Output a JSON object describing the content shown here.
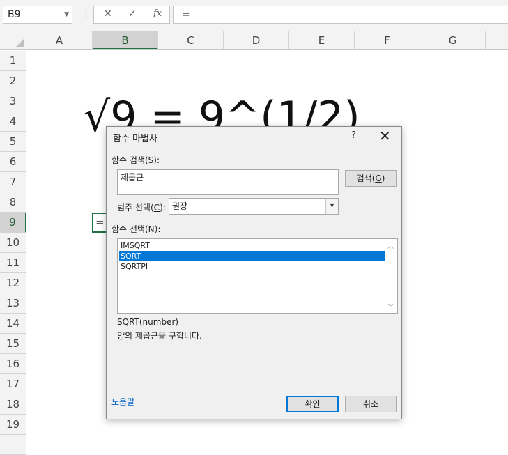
{
  "formula_bar": {
    "name_box": "B9",
    "cancel_glyph": "✕",
    "enter_glyph": "✓",
    "fx_label": "fx",
    "formula": "="
  },
  "columns": [
    "A",
    "B",
    "C",
    "D",
    "E",
    "F",
    "G"
  ],
  "rows": [
    "1",
    "2",
    "3",
    "4",
    "5",
    "6",
    "7",
    "8",
    "9",
    "10",
    "11",
    "12",
    "13",
    "14",
    "15",
    "16",
    "17",
    "18",
    "19"
  ],
  "selected_cell": {
    "column": "B",
    "row": "9",
    "value": "="
  },
  "sheet_text": "√9 = 9^(1/2)",
  "dialog": {
    "title": "함수 마법사",
    "help": "?",
    "close": "✕",
    "search_label": "함수 검색(",
    "search_key": "S",
    "search_label_end": "):",
    "search_value": "제곱근",
    "search_button": "검색(",
    "search_button_key": "G",
    "search_button_end": ")",
    "category_label": "범주 선택(",
    "category_key": "C",
    "category_label_end": "):",
    "category_value": "권장",
    "function_label": "함수 선택(",
    "function_key": "N",
    "function_label_end": "):",
    "functions": [
      "IMSQRT",
      "SQRT",
      "SQRTPI"
    ],
    "selected_function": "SQRT",
    "syntax": "SQRT(number)",
    "description": "양의 제곱근을 구합니다.",
    "help_link": "도움말",
    "ok_button": "확인",
    "cancel_button": "취소"
  },
  "colors": {
    "accent_green": "#217346",
    "selection_blue": "#0078d7",
    "link_blue": "#0066cc"
  }
}
